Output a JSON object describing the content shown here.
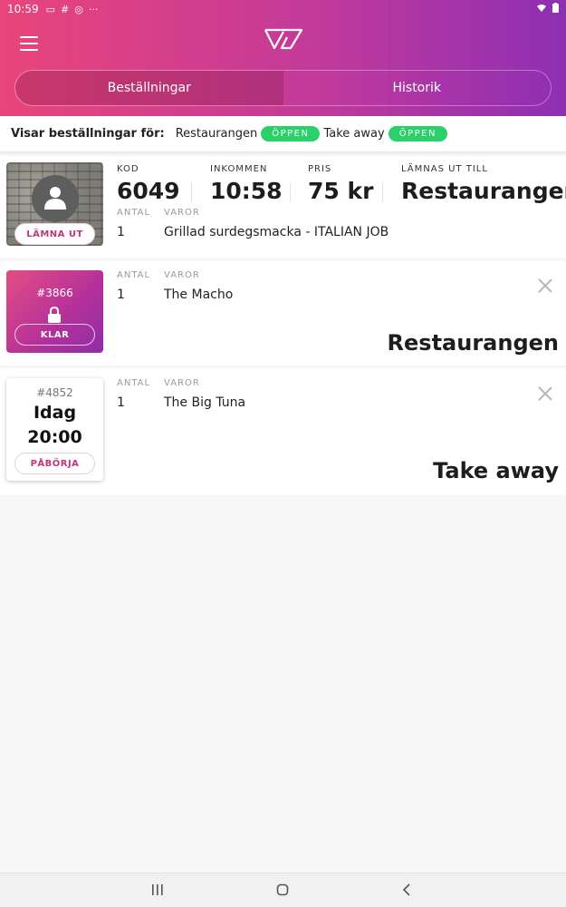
{
  "status_bar": {
    "time": "10:59"
  },
  "header": {
    "tabs": [
      {
        "label": "Beställningar",
        "active": true
      },
      {
        "label": "Historik",
        "active": false
      }
    ]
  },
  "filter": {
    "label": "Visar beställningar för:",
    "locations": [
      {
        "name": "Restaurangen",
        "status": "ÖPPEN"
      },
      {
        "name": "Take away",
        "status": "ÖPPEN"
      }
    ]
  },
  "order1": {
    "button": "LÄMNA UT",
    "kod_label": "KOD",
    "kod": "6049",
    "inkommen_label": "INKOMMEN",
    "inkommen": "10:58",
    "pris_label": "PRIS",
    "pris": "75 kr",
    "lamnas_label": "LÄMNAS UT TILL",
    "lamnas": "Restaurangen",
    "antal_label": "ANTAL",
    "varor_label": "VAROR",
    "items": [
      {
        "qty": "1",
        "name": "Grillad surdegsmacka - ITALIAN JOB"
      }
    ]
  },
  "order2": {
    "number": "#3866",
    "button": "KLAR",
    "antal_label": "ANTAL",
    "varor_label": "VAROR",
    "items": [
      {
        "qty": "1",
        "name": "The Macho"
      }
    ],
    "destination": "Restaurangen"
  },
  "order3": {
    "number": "#4852",
    "day": "Idag",
    "time": "20:00",
    "button": "PÅBÖRJA",
    "antal_label": "ANTAL",
    "varor_label": "VAROR",
    "items": [
      {
        "qty": "1",
        "name": "The Big Tuna"
      }
    ],
    "destination": "Take away"
  },
  "colors": {
    "header_gradient_start": "#e9457a",
    "header_gradient_end": "#8e2fb4",
    "open_badge": "#2bd06b",
    "accent": "#c0357f"
  }
}
